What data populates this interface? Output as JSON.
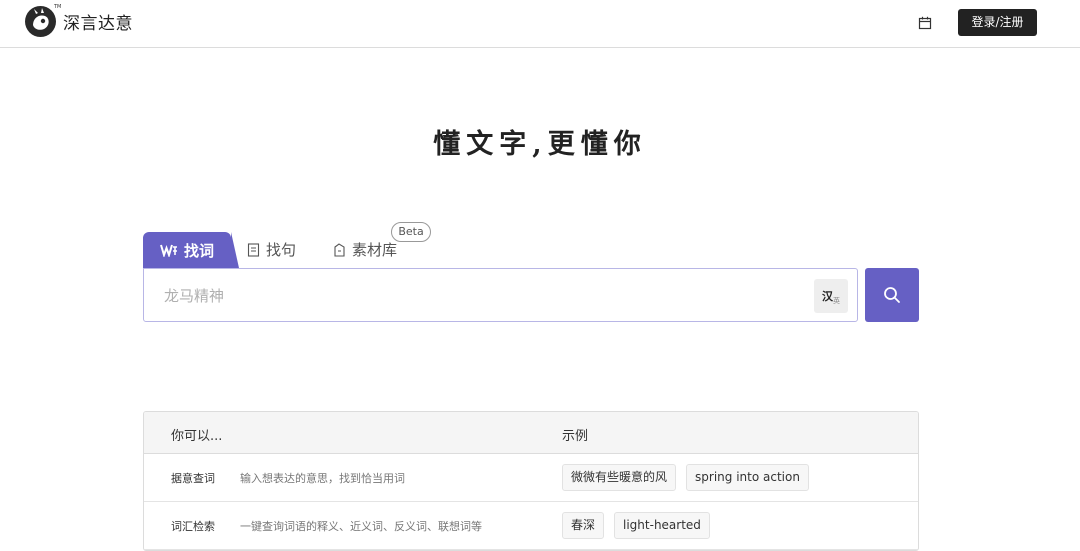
{
  "header": {
    "logo_text": "深言达意",
    "logo_tm": "TM",
    "calendar_icon": "calendar-icon",
    "login_label": "登录/注册"
  },
  "hero": {
    "slogan": "懂文字,更懂你"
  },
  "tabs": [
    {
      "label": "找词",
      "icon": "word-icon",
      "active": true
    },
    {
      "label": "找句",
      "icon": "document-icon",
      "active": false
    },
    {
      "label": "素材库",
      "icon": "bookmark-icon",
      "active": false
    }
  ],
  "beta_badge": "Beta",
  "search": {
    "placeholder": "龙马精神",
    "lang_toggle": "汉",
    "lang_toggle_sub": "英",
    "button_icon": "search-icon"
  },
  "help_table": {
    "col_you_can": "你可以...",
    "col_examples": "示例",
    "rows": [
      {
        "name": "据意查词",
        "desc": "输入想表达的意思，找到恰当用词",
        "examples": [
          "微微有些暖意的风",
          "spring into action"
        ]
      },
      {
        "name": "词汇检索",
        "desc": "一键查询词语的释义、近义词、反义词、联想词等",
        "examples": [
          "春深",
          "light-hearted"
        ]
      }
    ]
  },
  "colors": {
    "accent": "#6660c4",
    "dark": "#222222"
  }
}
